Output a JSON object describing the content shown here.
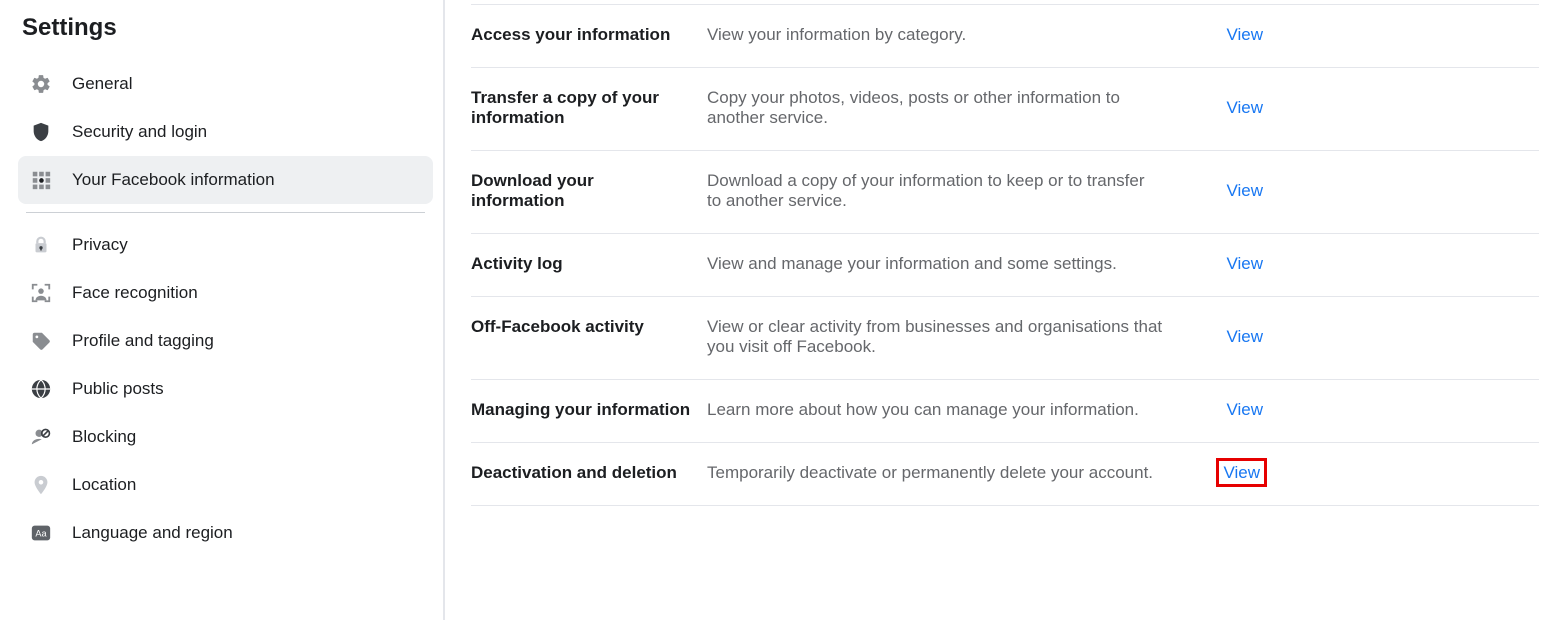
{
  "sidebar": {
    "title": "Settings",
    "items": [
      {
        "label": "General"
      },
      {
        "label": "Security and login"
      },
      {
        "label": "Your Facebook information"
      },
      {
        "label": "Privacy"
      },
      {
        "label": "Face recognition"
      },
      {
        "label": "Profile and tagging"
      },
      {
        "label": "Public posts"
      },
      {
        "label": "Blocking"
      },
      {
        "label": "Location"
      },
      {
        "label": "Language and region"
      }
    ]
  },
  "main": {
    "rows": [
      {
        "title": "Access your information",
        "desc": "View your information by category.",
        "action": "View"
      },
      {
        "title": "Transfer a copy of your information",
        "desc": "Copy your photos, videos, posts or other information to another service.",
        "action": "View"
      },
      {
        "title": "Download your information",
        "desc": "Download a copy of your information to keep or to transfer to another service.",
        "action": "View"
      },
      {
        "title": "Activity log",
        "desc": "View and manage your information and some settings.",
        "action": "View"
      },
      {
        "title": "Off-Facebook activity",
        "desc": "View or clear activity from businesses and organisations that you visit off Facebook.",
        "action": "View"
      },
      {
        "title": "Managing your information",
        "desc": "Learn more about how you can manage your information.",
        "action": "View"
      },
      {
        "title": "Deactivation and deletion",
        "desc": "Temporarily deactivate or permanently delete your account.",
        "action": "View"
      }
    ]
  }
}
